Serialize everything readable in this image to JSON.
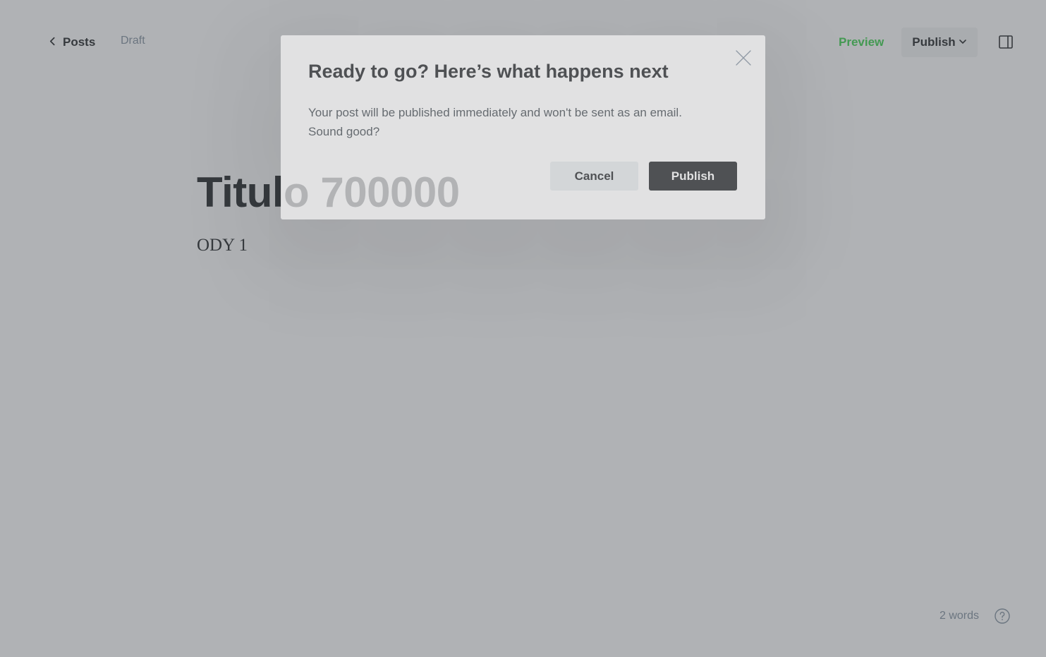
{
  "topbar": {
    "back_label": "Posts",
    "status": "Draft",
    "preview_label": "Preview",
    "publish_label": "Publish"
  },
  "editor": {
    "title": "Titulo 700000",
    "body": "ODY 1"
  },
  "footer": {
    "word_count": "2 words"
  },
  "modal": {
    "title": "Ready to go? Here’s what happens next",
    "message_line1": "Your post will be published immediately and won't be sent as an email.",
    "message_line2": "Sound good?",
    "cancel_label": "Cancel",
    "confirm_label": "Publish"
  },
  "colors": {
    "accent_green": "#30cf43",
    "primary_dark": "#15171a",
    "muted_text": "#7c8b9a"
  },
  "icons": [
    "chevron-left-icon",
    "chevron-down-icon",
    "sidebar-toggle-icon",
    "close-icon",
    "help-icon"
  ]
}
